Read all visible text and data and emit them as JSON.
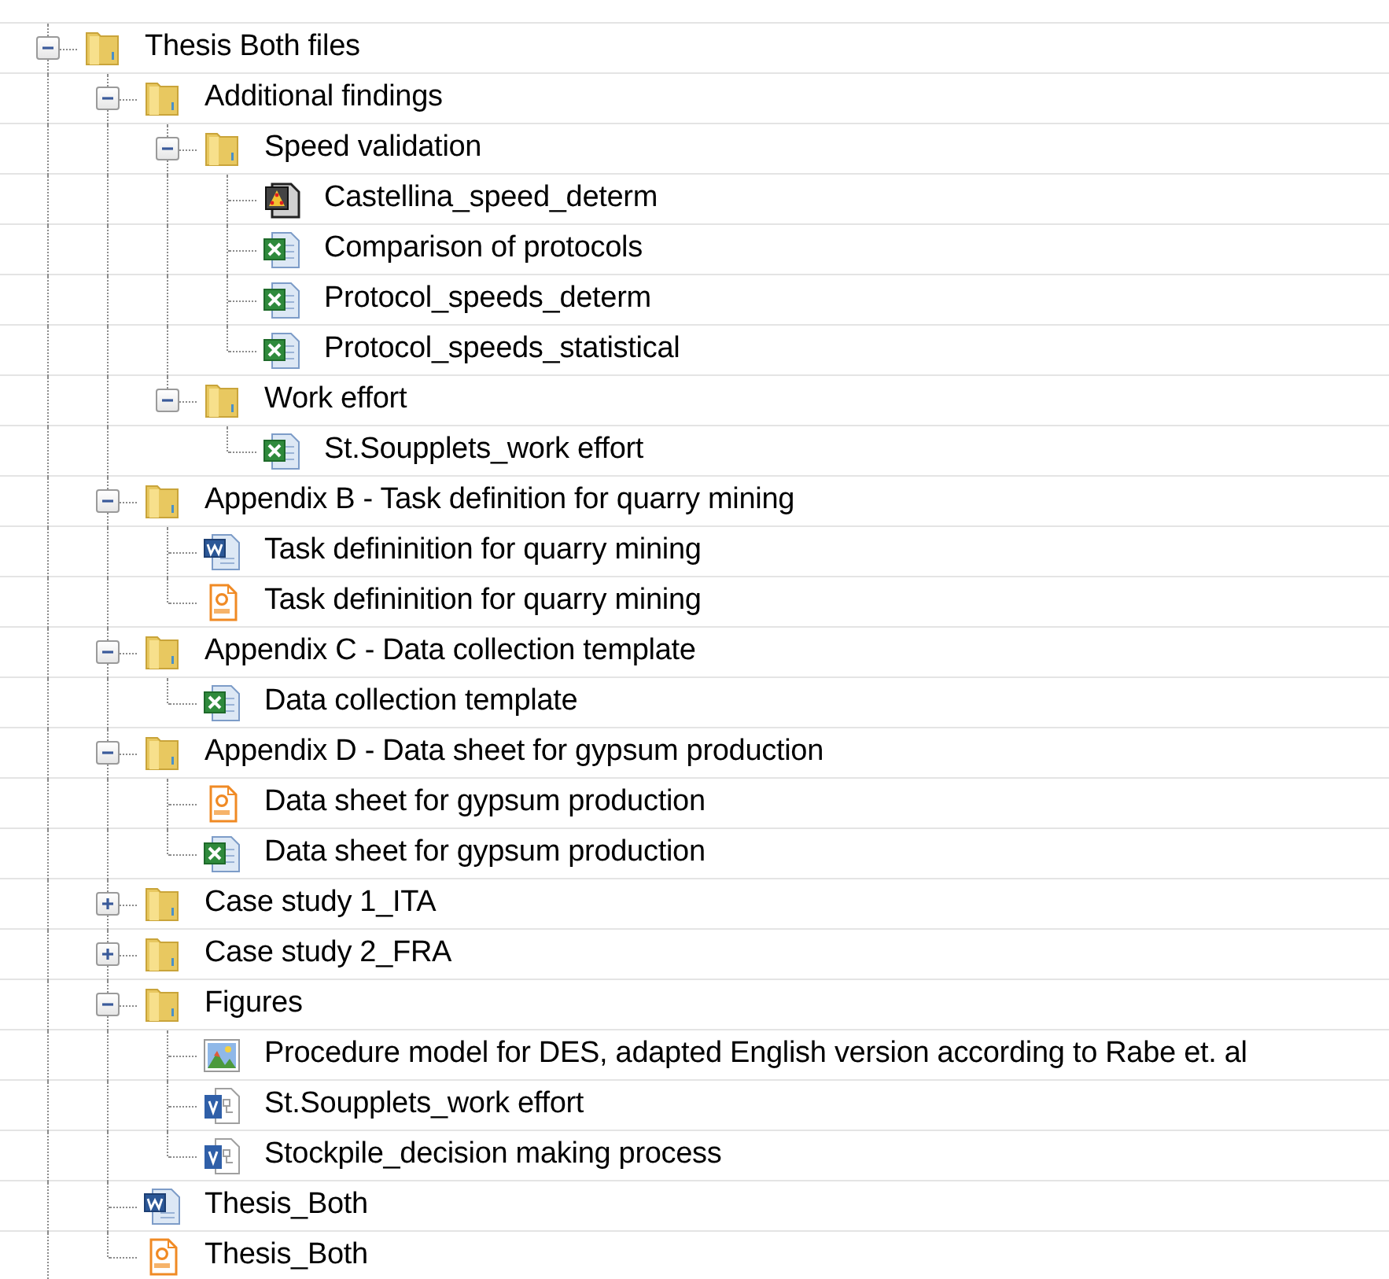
{
  "tree": [
    {
      "label": "Thesis Both files",
      "kind": "folder",
      "expanded": true,
      "children": [
        {
          "label": "Additional findings",
          "kind": "folder",
          "expanded": true,
          "children": [
            {
              "label": "Speed validation",
              "kind": "folder",
              "expanded": true,
              "children": [
                {
                  "label": "Castellina_speed_determ",
                  "kind": "model"
                },
                {
                  "label": "Comparison of protocols",
                  "kind": "excel"
                },
                {
                  "label": "Protocol_speeds_determ",
                  "kind": "excel"
                },
                {
                  "label": "Protocol_speeds_statistical",
                  "kind": "excel"
                }
              ]
            },
            {
              "label": "Work effort",
              "kind": "folder",
              "expanded": true,
              "children": [
                {
                  "label": "St.Soupplets_work effort",
                  "kind": "excel"
                }
              ]
            }
          ]
        },
        {
          "label": "Appendix B - Task definition for quarry mining",
          "kind": "folder",
          "expanded": true,
          "children": [
            {
              "label": "Task defininition for quarry mining",
              "kind": "word"
            },
            {
              "label": "Task defininition for quarry mining",
              "kind": "pdf"
            }
          ]
        },
        {
          "label": "Appendix C - Data collection template",
          "kind": "folder",
          "expanded": true,
          "children": [
            {
              "label": "Data collection template",
              "kind": "excel"
            }
          ]
        },
        {
          "label": "Appendix D - Data sheet for gypsum production",
          "kind": "folder",
          "expanded": true,
          "children": [
            {
              "label": "Data sheet for gypsum production",
              "kind": "pdf"
            },
            {
              "label": "Data sheet for gypsum production",
              "kind": "excel"
            }
          ]
        },
        {
          "label": "Case study 1_ITA",
          "kind": "folder",
          "expanded": false
        },
        {
          "label": "Case study 2_FRA",
          "kind": "folder",
          "expanded": false
        },
        {
          "label": "Figures",
          "kind": "folder",
          "expanded": true,
          "children": [
            {
              "label": "Procedure model for DES, adapted English version according to Rabe et. al",
              "kind": "image"
            },
            {
              "label": "St.Soupplets_work effort",
              "kind": "visio"
            },
            {
              "label": "Stockpile_decision making process",
              "kind": "visio"
            }
          ]
        },
        {
          "label": "Thesis_Both",
          "kind": "word"
        },
        {
          "label": "Thesis_Both",
          "kind": "pdf"
        }
      ]
    }
  ]
}
